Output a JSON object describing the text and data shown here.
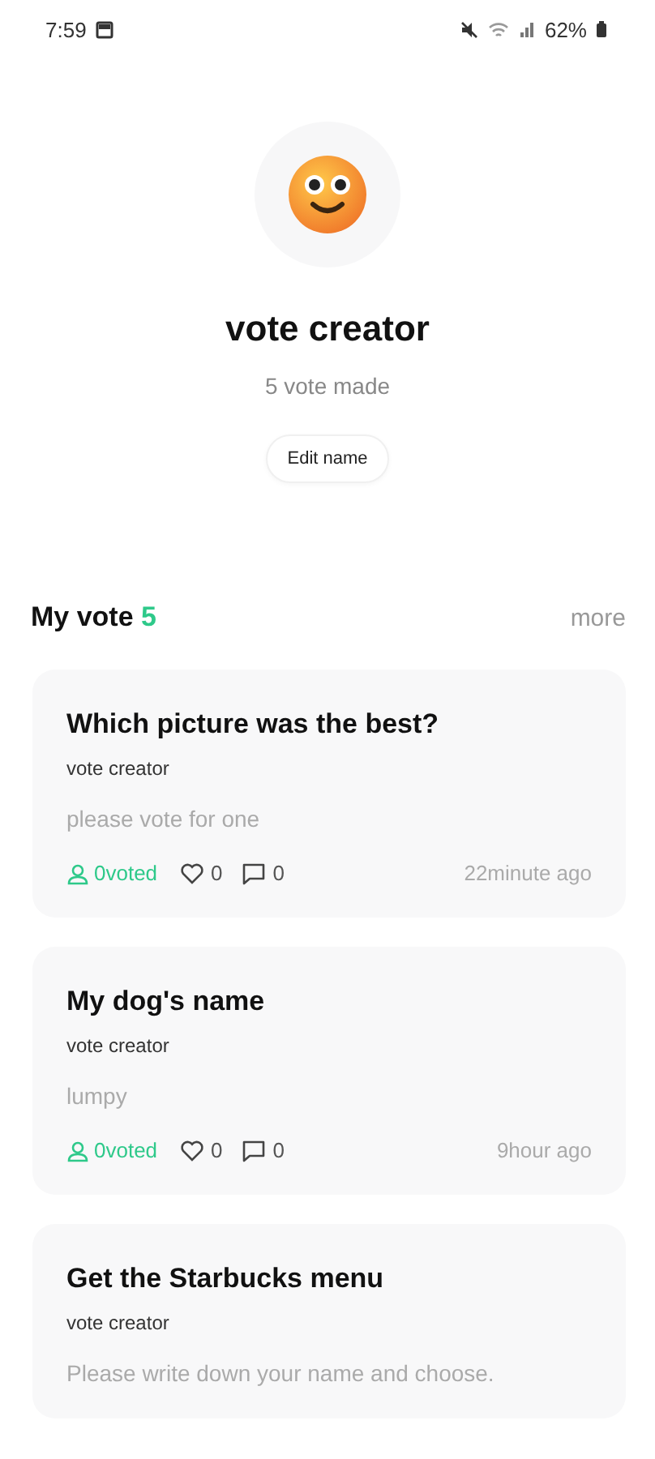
{
  "status_bar": {
    "time": "7:59",
    "battery": "62%"
  },
  "profile": {
    "name": "vote creator",
    "subtitle": "5 vote made",
    "edit_button": "Edit name"
  },
  "section": {
    "title": "My vote",
    "count": "5",
    "more": "more"
  },
  "votes": [
    {
      "title": "Which picture was the best?",
      "author": "vote creator",
      "description": "please vote for one",
      "voted": "0voted",
      "likes": "0",
      "comments": "0",
      "time": "22minute ago"
    },
    {
      "title": "My dog's name",
      "author": "vote creator",
      "description": "lumpy",
      "voted": "0voted",
      "likes": "0",
      "comments": "0",
      "time": "9hour ago"
    },
    {
      "title": "Get the Starbucks menu",
      "author": "vote creator",
      "description": "Please write down your name and choose."
    }
  ]
}
